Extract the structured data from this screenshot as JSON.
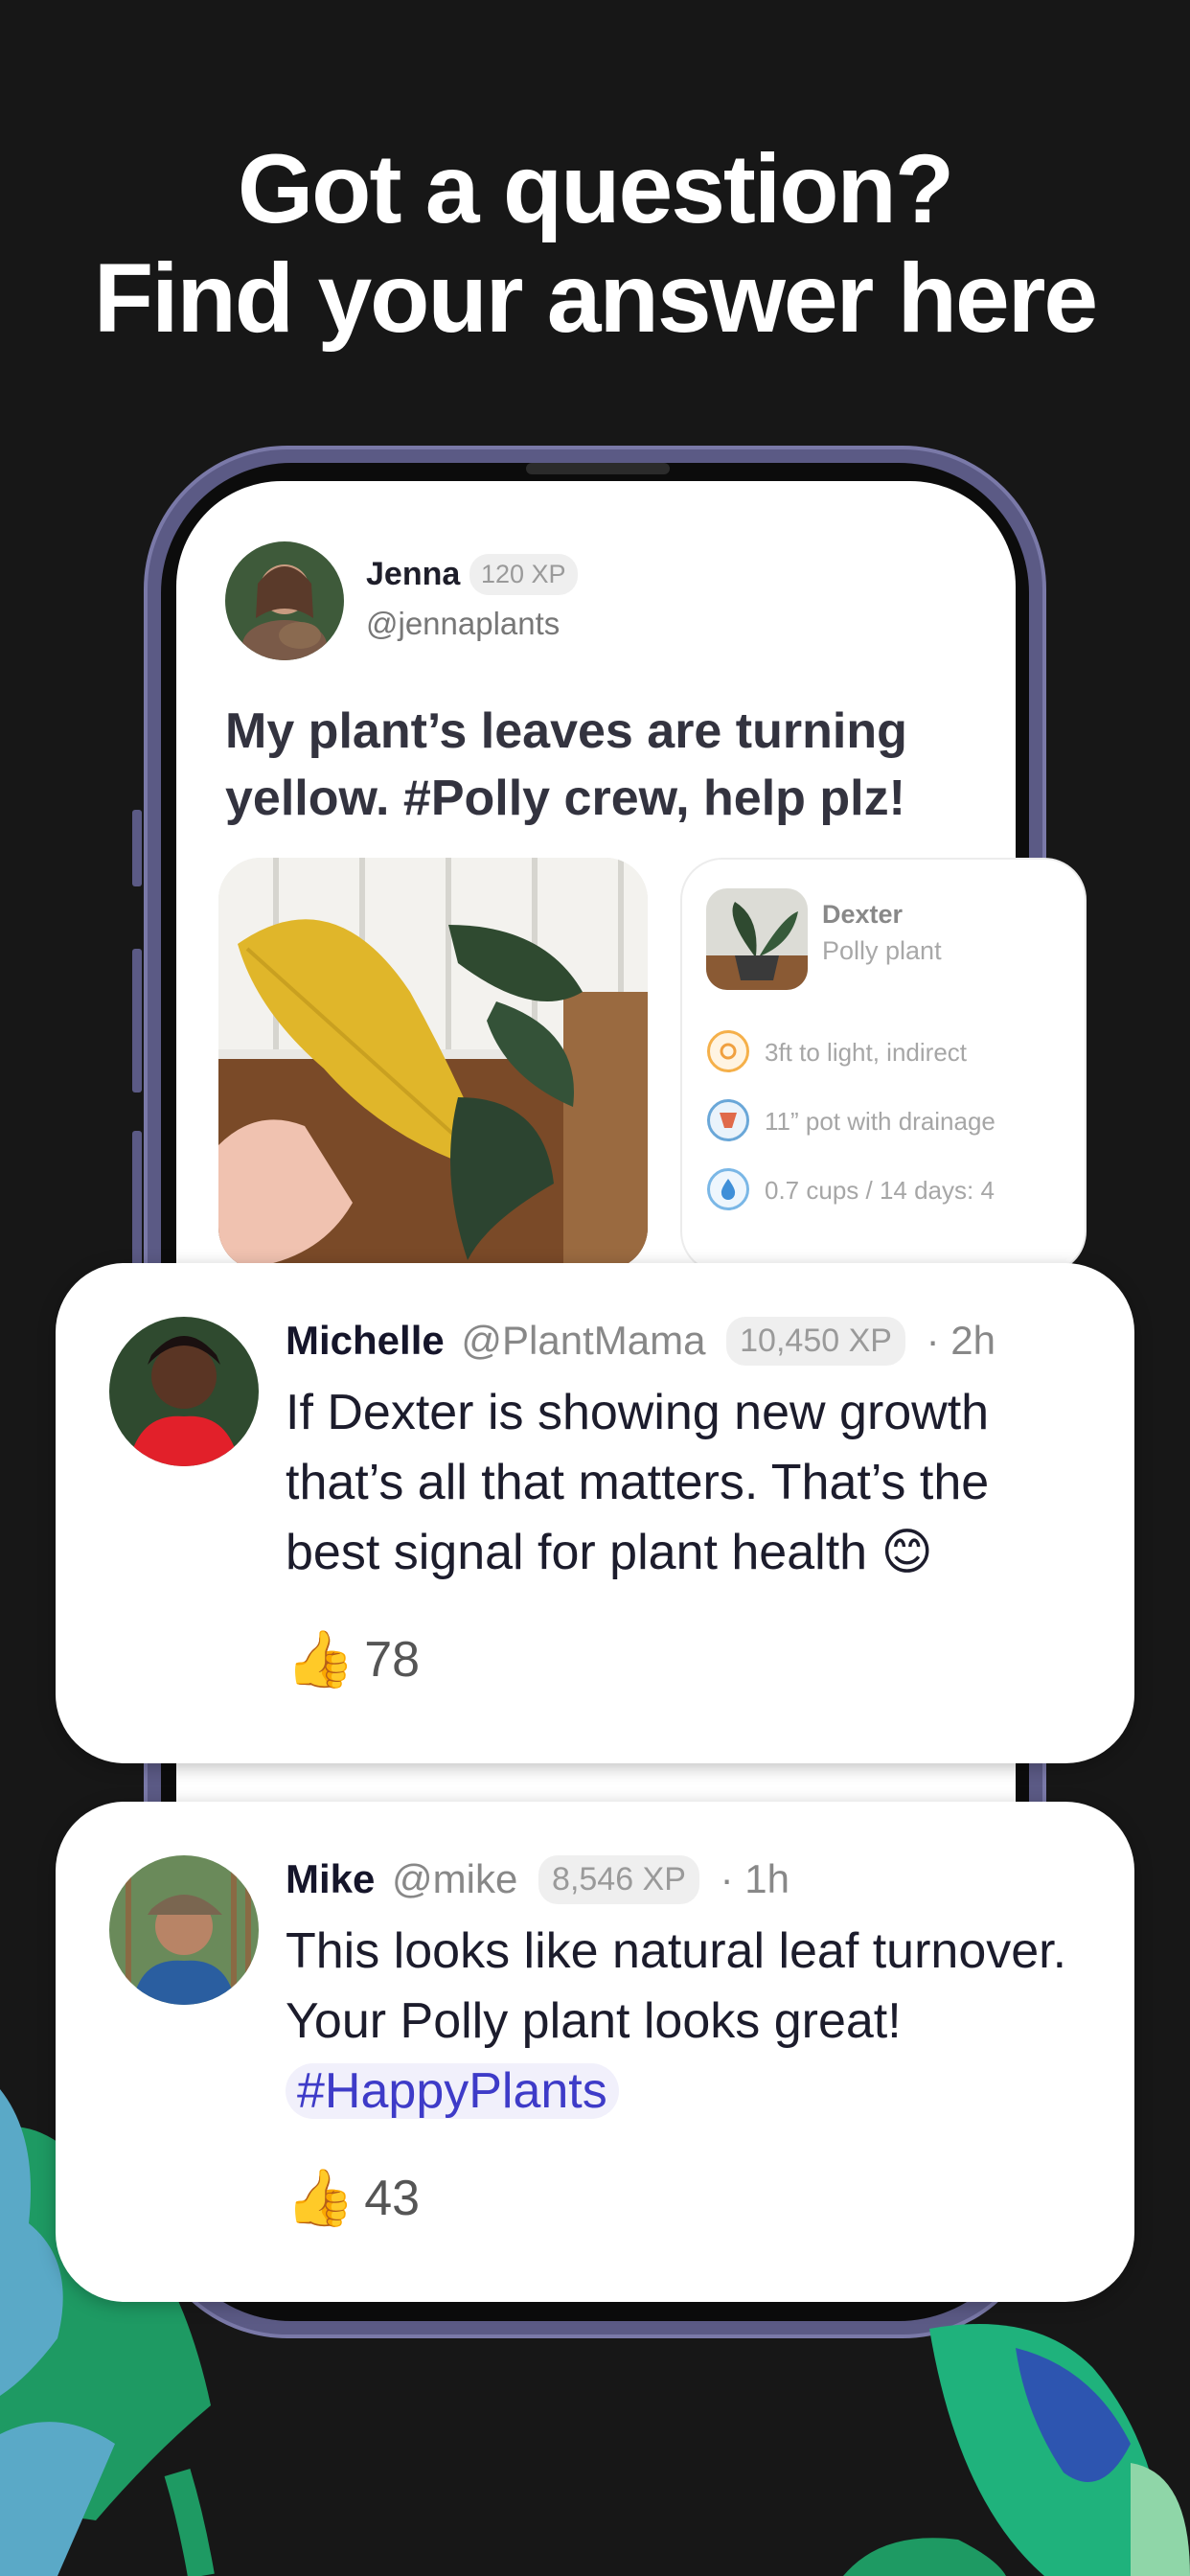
{
  "headline": {
    "line1": "Got a question?",
    "line2": "Find your answer here"
  },
  "post": {
    "author_name": "Jenna",
    "author_xp": "120 XP",
    "author_handle": "@jennaplants",
    "text": "My plant’s leaves are turning yellow. #Polly crew, help plz!",
    "plant_card": {
      "name": "Dexter",
      "type": "Polly plant",
      "specs": [
        {
          "icon": "sun-icon",
          "text": "3ft to light, indirect"
        },
        {
          "icon": "pot-icon",
          "text": "11” pot with drainage"
        },
        {
          "icon": "water-drop-icon",
          "text": "0.7 cups / 14 days: 4"
        }
      ]
    }
  },
  "comments": [
    {
      "name": "Michelle",
      "handle": "@PlantMama",
      "xp": "10,450 XP",
      "time": "· 2h",
      "text": "If Dexter is showing new growth that’s all that matters. That’s the best signal for plant health",
      "emoji": "😊",
      "likes": "78"
    },
    {
      "name": "Mike",
      "handle": "@mike",
      "xp": "8,546 XP",
      "time": "· 1h",
      "text": "This looks like natural leaf turnover. Your Polly plant looks great!",
      "hashtag": "#HappyPlants",
      "likes": "43"
    }
  ],
  "colors": {
    "background": "#171717",
    "phone_frame": "#5b5a85",
    "hashtag": "#3e3bc8",
    "leaf_green": "#1e9a63",
    "leaf_blue": "#5aa9c7"
  }
}
